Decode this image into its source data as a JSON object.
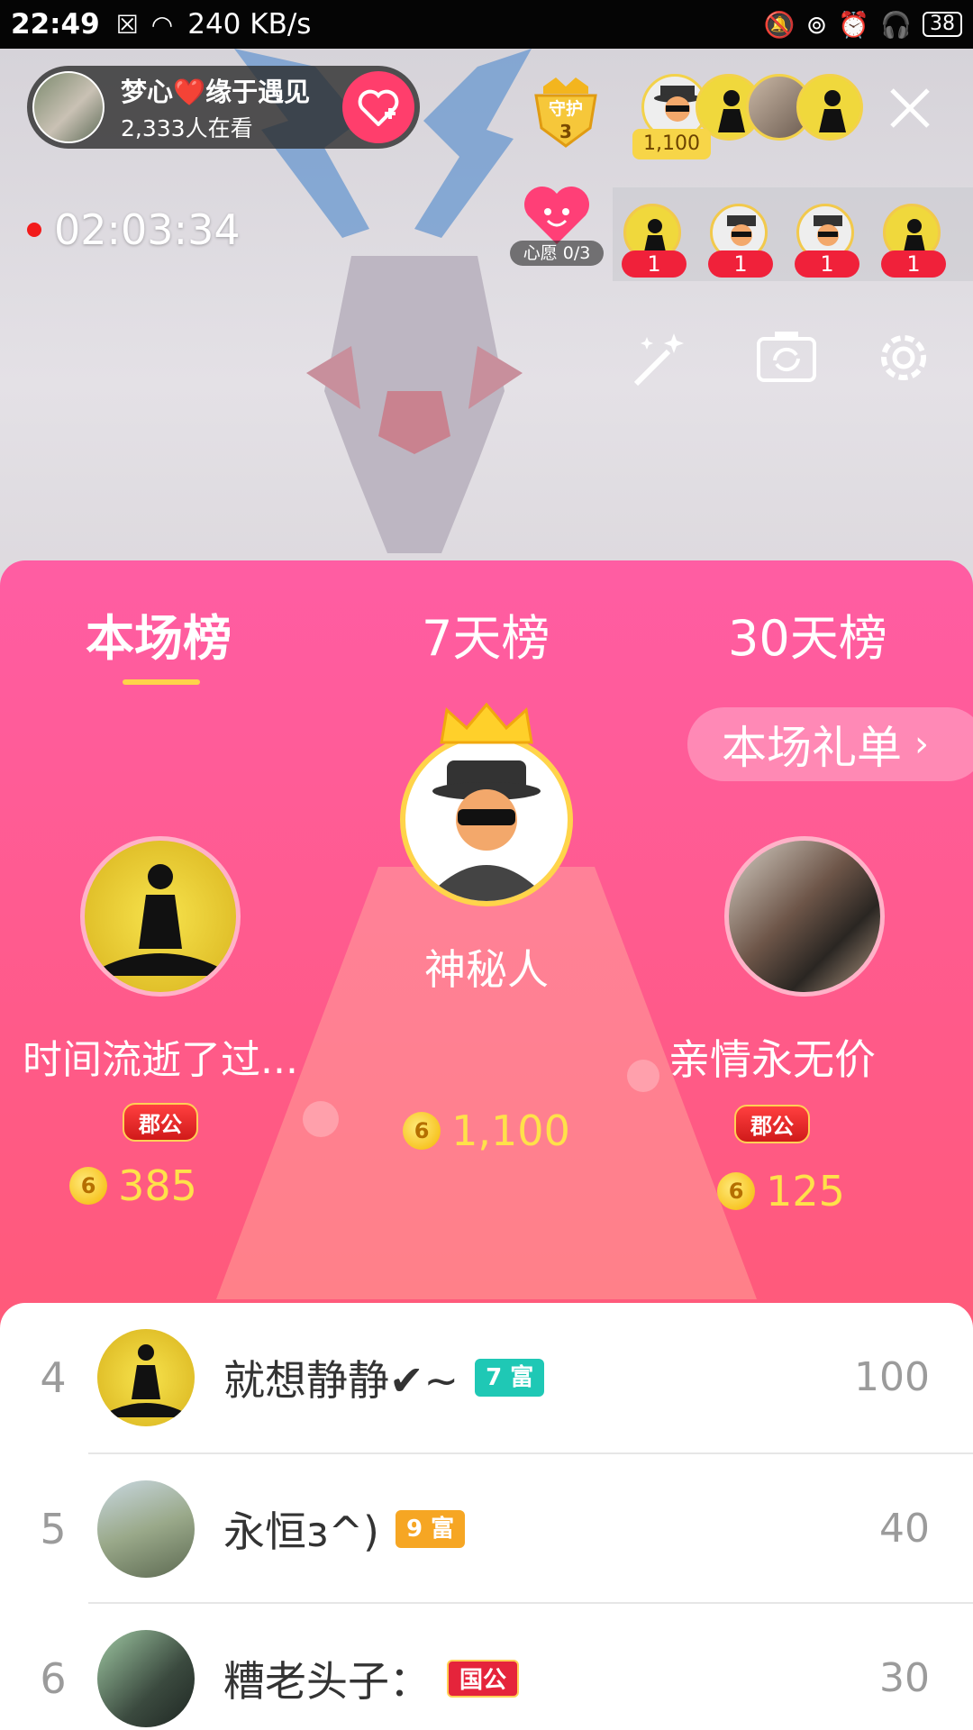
{
  "status_bar": {
    "time": "22:49",
    "speed": "240 KB/s",
    "battery": "38"
  },
  "host": {
    "name": "梦心❤️缘于遇见",
    "viewers": "2,333人在看"
  },
  "guard": {
    "label": "守护",
    "count": "3"
  },
  "top_viewer_score": "1,100",
  "timer": "02:03:34",
  "wish": {
    "label": "心愿 0/3"
  },
  "rank_strip": [
    "1",
    "1",
    "1",
    "1"
  ],
  "tabs": [
    "本场榜",
    "7天榜",
    "30天榜"
  ],
  "gift_list_label": "本场礼单",
  "top3": {
    "first": {
      "name": "神秘人",
      "score": "1,100"
    },
    "second": {
      "name": "时间流逝了过...",
      "badge": "郡公",
      "score": "385"
    },
    "third": {
      "name": "亲情永无价",
      "badge": "郡公",
      "score": "125"
    }
  },
  "coin_symbol": "6",
  "list": [
    {
      "rank": "4",
      "name": "就想静静✔~",
      "level": "7 富",
      "level_color": "#1fc8b5",
      "score": "100"
    },
    {
      "rank": "5",
      "name": "永恒з^)",
      "level": "9 富",
      "level_color": "#f6a623",
      "score": "40"
    },
    {
      "rank": "6",
      "name": "糟老头子：",
      "level": "国公",
      "level_color": "#e5243b",
      "score": "30"
    }
  ],
  "colors": {
    "panel_top": "#ff5da3",
    "panel_bottom": "#ff5a66",
    "gold": "#ffe14a",
    "accent_red": "#ff3e6c"
  }
}
